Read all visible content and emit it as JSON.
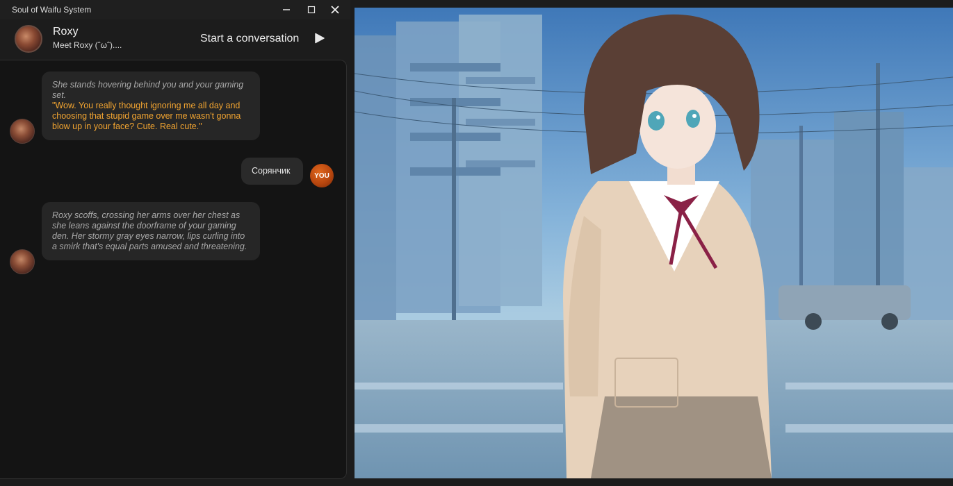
{
  "window": {
    "title": "Soul of Waifu System",
    "controls": {
      "minimize_icon": "minimize-icon",
      "maximize_icon": "maximize-icon",
      "close_icon": "close-icon"
    }
  },
  "header": {
    "character_name": "Roxy",
    "character_subtitle": "Meet Roxy (ˆωˆ)....",
    "start_label": "Start a conversation",
    "start_icon": "play-icon"
  },
  "chat": {
    "messages": [
      {
        "sender": "character",
        "action": "She stands hovering behind you and your gaming set.",
        "speech": "\"Wow. You really thought ignoring me all day and choosing that stupid game over me wasn't gonna blow up in your face? Cute. Real cute.\""
      },
      {
        "sender": "user",
        "text": "Сорянчик",
        "avatar_label": "YOU"
      },
      {
        "sender": "character",
        "action": "Roxy scoffs, crossing her arms over her chest as she leans against the doorframe of your gaming den. Her stormy gray eyes narrow, lips curling into a smirk that's equal parts amused and threatening.",
        "speech": ""
      }
    ]
  },
  "colors": {
    "background": "#1c1c1c",
    "chat_panel": "#141414",
    "bubble": "#262626",
    "action_text": "#a9a9a9",
    "speech_text": "#f3a531",
    "user_avatar": "#d05a16"
  }
}
